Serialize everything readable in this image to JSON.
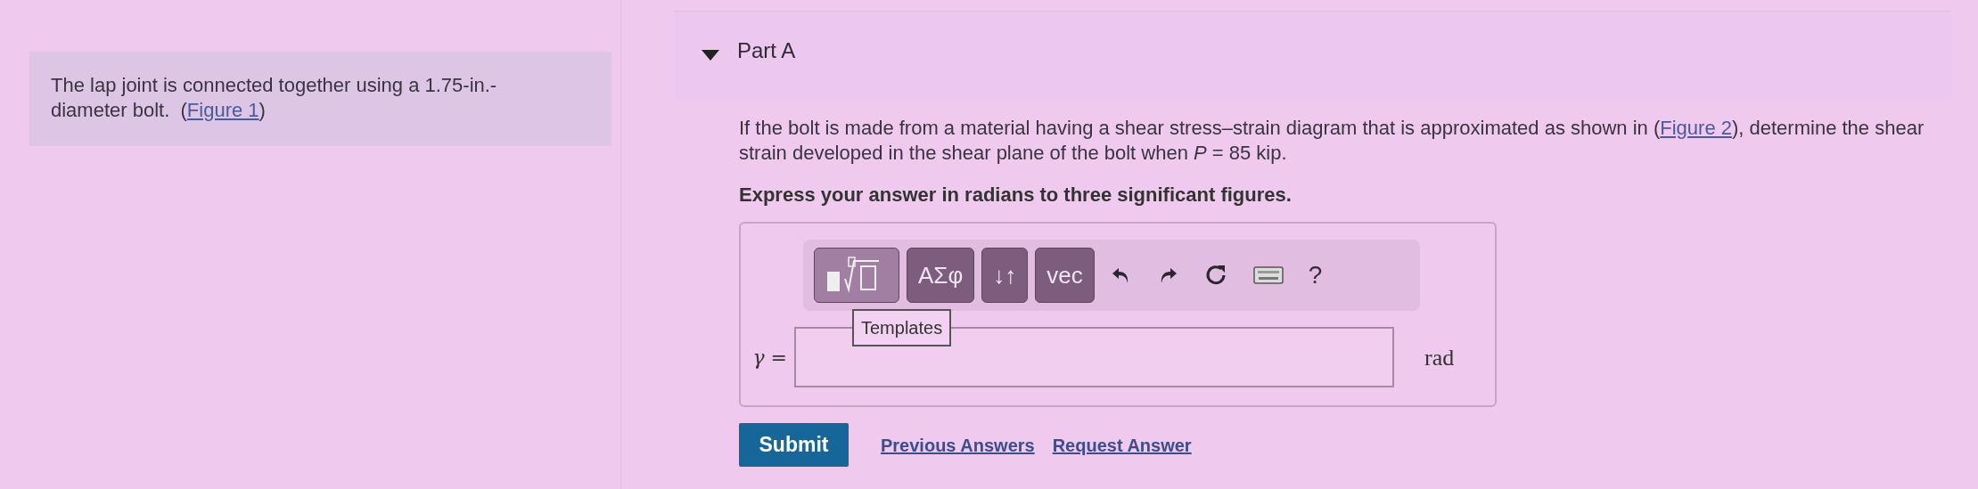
{
  "intro": {
    "text": "The lap joint is connected together using a 1.75-in.-diameter bolt.  (",
    "link": "Figure 1",
    "after": ")"
  },
  "part": {
    "title": "Part A",
    "expanded": true
  },
  "question": {
    "before": "If the bolt is made from a material having a shear stress–strain diagram that is approximated as shown in (",
    "link": "Figure 2",
    "after": "), determine the shear strain developed in the shear plane of the bolt when *P* = 85 kip."
  },
  "instruction": "Express your answer in radians to three significant figures.",
  "toolbar": [
    {
      "kind": "templates",
      "disabled": true
    },
    {
      "kind": "text",
      "label": "ΑΣφ",
      "disabled": false
    },
    {
      "kind": "text",
      "label": "↓↑",
      "disabled": false
    },
    {
      "kind": "text",
      "label": "vec",
      "disabled": false
    },
    {
      "kind": "undo"
    },
    {
      "kind": "redo"
    },
    {
      "kind": "reset"
    },
    {
      "kind": "keyboard"
    },
    {
      "kind": "help",
      "label": "?"
    }
  ],
  "tooltip": "Templates",
  "answer": {
    "label": "γ =",
    "unit": "rad"
  },
  "actions": {
    "submit": "Submit",
    "links": [
      "Previous Answers",
      "Request Answer"
    ]
  }
}
